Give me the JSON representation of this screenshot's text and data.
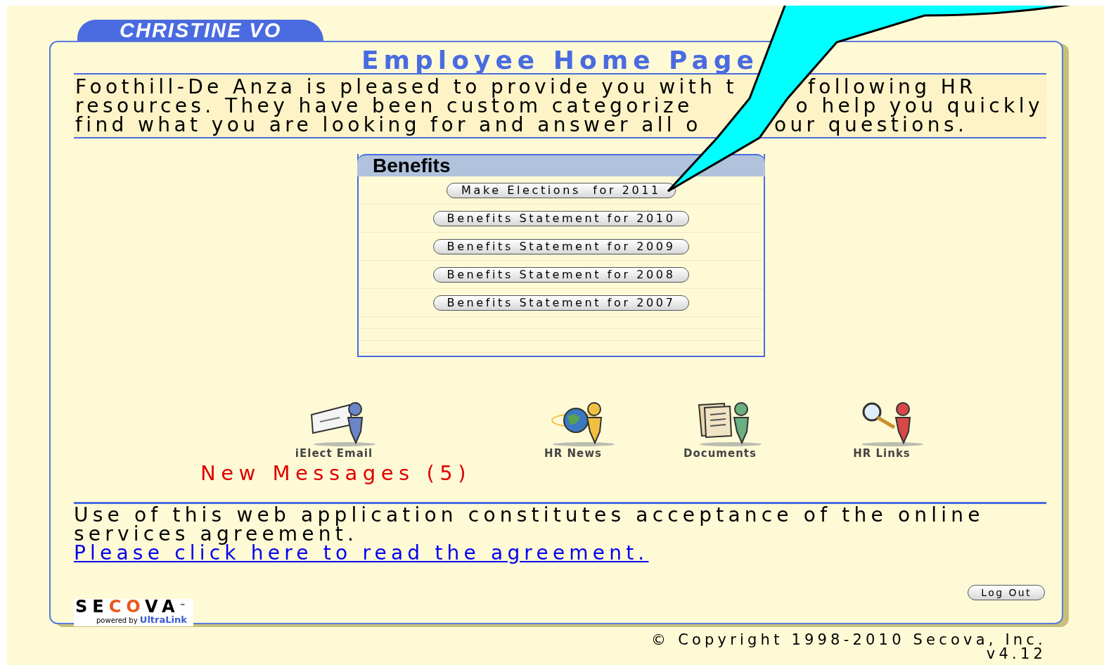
{
  "user_tab": "CHRISTINE VO",
  "title": "Employee Home Page",
  "intro_lines": [
    {
      "before": "Foothill-De Anza is pleased to provide you with t",
      "after": "following HR"
    },
    {
      "before": "resources. They have been custom categorize",
      "after": "o help you quickly"
    },
    {
      "before": "find what you are looking for and answer all o",
      "after": "our questions."
    }
  ],
  "benefits": {
    "title": "Benefits",
    "buttons": [
      "Make Elections  for 2011",
      "Benefits Statement for 2010",
      "Benefits Statement for 2009",
      "Benefits Statement for 2008",
      "Benefits Statement for 2007"
    ]
  },
  "shortcuts": [
    {
      "label": "iElect Email",
      "kind": "email"
    },
    {
      "label": "HR News",
      "kind": "news"
    },
    {
      "label": "Documents",
      "kind": "documents"
    },
    {
      "label": "HR Links",
      "kind": "links"
    }
  ],
  "new_messages": "New Messages (5)",
  "agreement": {
    "text": "Use of this web application constitutes acceptance of the online services agreement.",
    "link": "Please click here to read the agreement."
  },
  "logout": "Log Out",
  "logo": {
    "segments": [
      {
        "text": "SE",
        "accent": false
      },
      {
        "text": "CO",
        "accent": true
      },
      {
        "text": "VA",
        "accent": false
      }
    ],
    "mark": "™",
    "powered_by": "powered by",
    "product": "UltraLink"
  },
  "copyright": "© Copyright 1998-2010 Secova, Inc.",
  "version": "v4.12"
}
